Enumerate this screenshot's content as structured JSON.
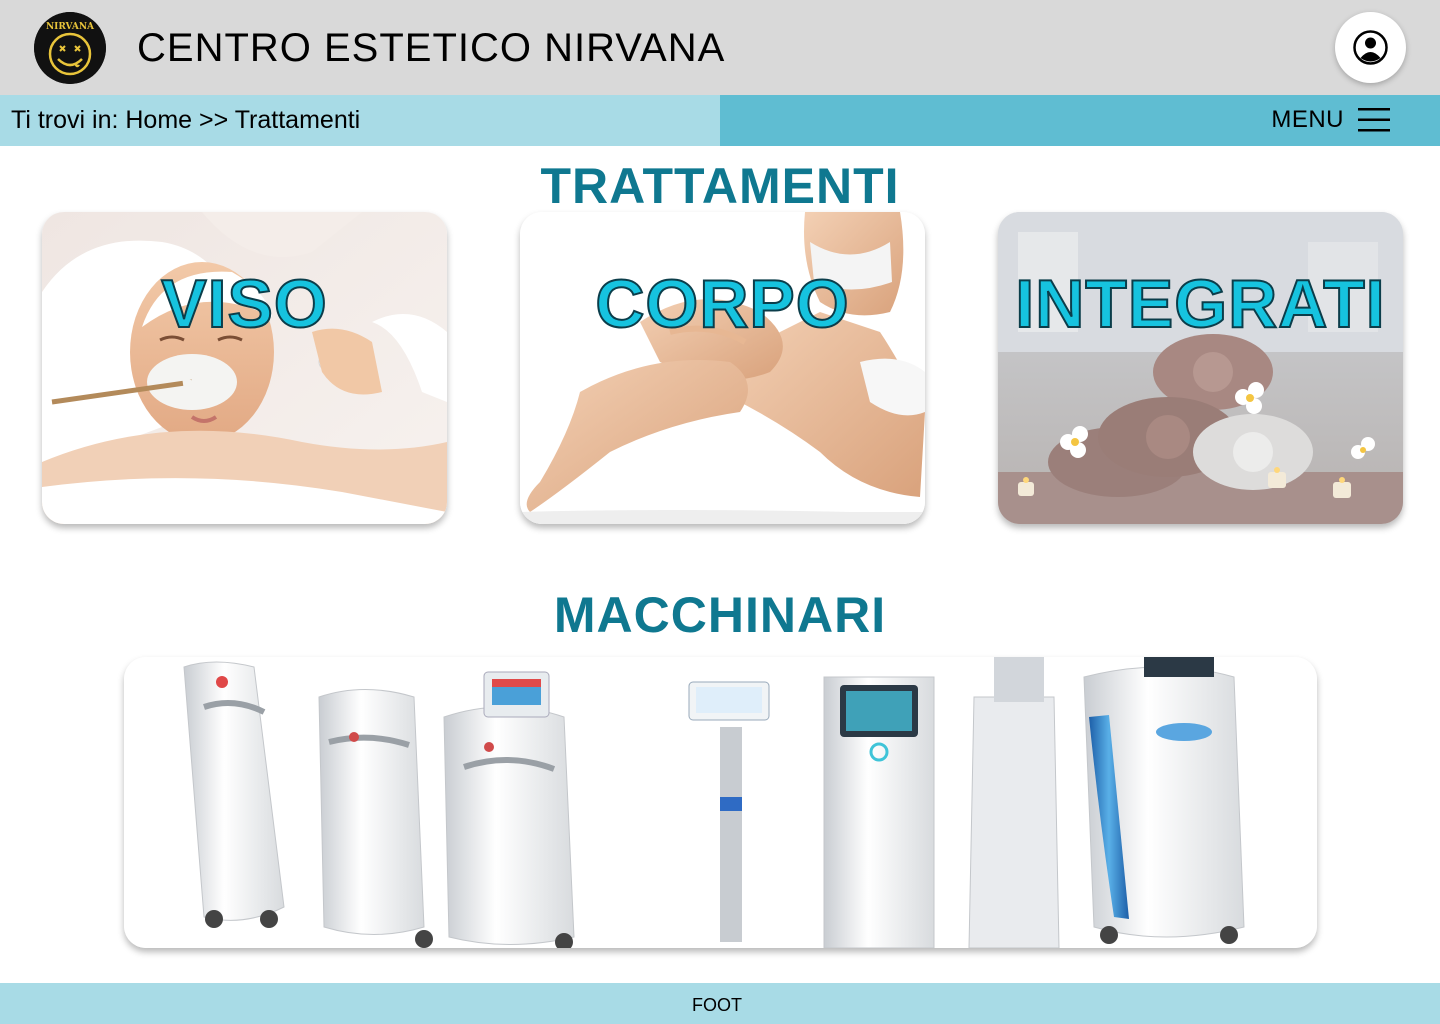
{
  "header": {
    "title": "CENTRO ESTETICO NIRVANA",
    "logo_text": "NIRVANA"
  },
  "nav": {
    "breadcrumb_prefix": "Ti trovi in:",
    "breadcrumb_home": "Home",
    "breadcrumb_separator": ">>",
    "breadcrumb_current": "Trattamenti",
    "menu_label": "MENU"
  },
  "treatments": {
    "title": "TRATTAMENTI",
    "cards": [
      {
        "label": "VISO"
      },
      {
        "label": "CORPO"
      },
      {
        "label": "INTEGRATI"
      }
    ]
  },
  "machines": {
    "title": "MACCHINARI"
  },
  "footer": {
    "text": "FOOT"
  },
  "colors": {
    "header_bg": "#d9d9d9",
    "breadcrumb_bg": "#a8dbe6",
    "menu_bg": "#5fbdd2",
    "section_title": "#0f7890",
    "card_label": "#16c3df",
    "footer_bg": "#a8dbe6"
  },
  "icons": {
    "logo": "nirvana-smiley-logo",
    "user": "user-account-icon",
    "menu": "hamburger-menu-icon"
  }
}
